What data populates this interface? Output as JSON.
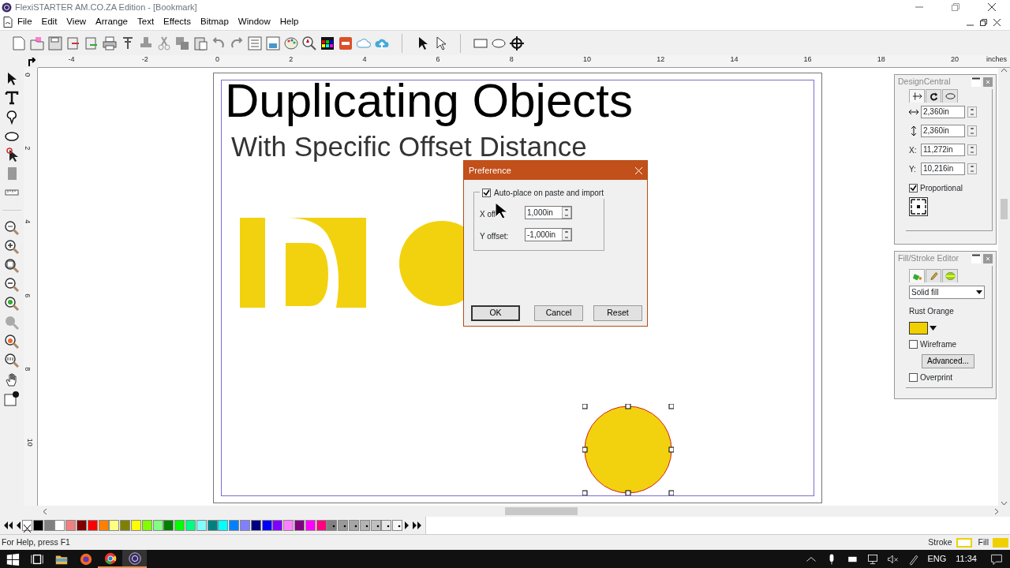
{
  "window": {
    "title": "FlexiSTARTER AM.CO.ZA Edition - [Bookmark]"
  },
  "menu": [
    {
      "label": "File"
    },
    {
      "label": "Edit"
    },
    {
      "label": "View"
    },
    {
      "label": "Arrange"
    },
    {
      "label": "Text"
    },
    {
      "label": "Effects"
    },
    {
      "label": "Bitmap"
    },
    {
      "label": "Window"
    },
    {
      "label": "Help"
    }
  ],
  "ruler_horizontal": {
    "labels": [
      "-4",
      "-2",
      "0",
      "2",
      "4",
      "6",
      "8",
      "10",
      "12",
      "14",
      "16",
      "18",
      "20"
    ],
    "unit": "inches"
  },
  "ruler_vertical": {
    "labels": [
      "0",
      "2",
      "4",
      "6",
      "8",
      "10"
    ]
  },
  "canvas": {
    "title": "Duplicating Objects",
    "subtitle": "With Specific Offset Distance"
  },
  "dialog": {
    "title": "Preference",
    "auto_place": {
      "label": "Auto-place on paste and import",
      "checked": true
    },
    "fields": [
      {
        "label": "X off",
        "value": "1,000in"
      },
      {
        "label": "Y offset:",
        "value": "-1,000in"
      }
    ],
    "buttons": [
      "OK",
      "Cancel",
      "Reset"
    ]
  },
  "design_central": {
    "title": "DesignCentral",
    "tabs": [
      {
        "selected": true
      },
      {
        "selected": false
      },
      {
        "selected": false
      }
    ],
    "fields": [
      {
        "kind": "width",
        "value": "2,360in"
      },
      {
        "kind": "height",
        "value": "2,360in"
      },
      {
        "kind": "text",
        "label": "X:",
        "value": "11,272in"
      },
      {
        "kind": "text",
        "label": "Y:",
        "value": "10,216in"
      }
    ],
    "proportional": {
      "label": "Proportional",
      "checked": true
    }
  },
  "fill_stroke_editor": {
    "title": "Fill/Stroke Editor",
    "tabs": [
      {
        "selected": true
      },
      {
        "selected": false
      },
      {
        "selected": false
      }
    ],
    "fill_type": "Solid fill",
    "color_name": "Rust Orange",
    "color": "#f0d000",
    "wireframe": {
      "label": "Wireframe",
      "checked": false
    },
    "advanced_button": "Advanced...",
    "overprint": {
      "label": "Overprint",
      "checked": false
    }
  },
  "palette": [
    {
      "kind": "none"
    },
    {
      "kind": "solid",
      "color": "#000000"
    },
    {
      "kind": "solid",
      "color": "#808080"
    },
    {
      "kind": "solid",
      "color": "#ffffff"
    },
    {
      "kind": "solid",
      "color": "#f08080"
    },
    {
      "kind": "solid",
      "color": "#800000"
    },
    {
      "kind": "solid",
      "color": "#ff0000"
    },
    {
      "kind": "solid",
      "color": "#ff8000"
    },
    {
      "kind": "solid",
      "color": "#ffff80"
    },
    {
      "kind": "solid",
      "color": "#808000"
    },
    {
      "kind": "solid",
      "color": "#ffff00"
    },
    {
      "kind": "solid",
      "color": "#80ff00"
    },
    {
      "kind": "solid",
      "color": "#80ff80"
    },
    {
      "kind": "solid",
      "color": "#008000"
    },
    {
      "kind": "solid",
      "color": "#00ff00"
    },
    {
      "kind": "solid",
      "color": "#00ff80"
    },
    {
      "kind": "solid",
      "color": "#80ffff"
    },
    {
      "kind": "solid",
      "color": "#008080"
    },
    {
      "kind": "solid",
      "color": "#00ffff"
    },
    {
      "kind": "solid",
      "color": "#0080ff"
    },
    {
      "kind": "solid",
      "color": "#8080ff"
    },
    {
      "kind": "solid",
      "color": "#000080"
    },
    {
      "kind": "solid",
      "color": "#0000ff"
    },
    {
      "kind": "solid",
      "color": "#8000ff"
    },
    {
      "kind": "solid",
      "color": "#ff80ff"
    },
    {
      "kind": "solid",
      "color": "#800080"
    },
    {
      "kind": "solid",
      "color": "#ff00ff"
    },
    {
      "kind": "solid",
      "color": "#ff0080"
    },
    {
      "kind": "spot",
      "color": "#808080"
    },
    {
      "kind": "spot",
      "color": "#999999"
    },
    {
      "kind": "spot",
      "color": "#a6a6a6"
    },
    {
      "kind": "spot",
      "color": "#b3b3b3"
    },
    {
      "kind": "spot",
      "color": "#c0c0c0"
    },
    {
      "kind": "spot",
      "color": "#e6e6e6"
    },
    {
      "kind": "spot",
      "color": "#f8f8f8"
    }
  ],
  "status_bar": {
    "help": "For Help, press F1",
    "stroke_label": "Stroke",
    "fill_label": "Fill"
  },
  "taskbar": {
    "language": "ENG",
    "time": "11:34"
  }
}
